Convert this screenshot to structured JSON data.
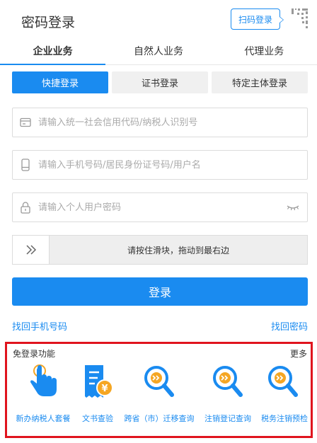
{
  "header": {
    "title": "密码登录",
    "scan_label": "扫码登录"
  },
  "tabs": [
    {
      "label": "企业业务",
      "active": true
    },
    {
      "label": "自然人业务",
      "active": false
    },
    {
      "label": "代理业务",
      "active": false
    }
  ],
  "login_modes": [
    {
      "label": "快捷登录",
      "active": true
    },
    {
      "label": "证书登录",
      "active": false
    },
    {
      "label": "特定主体登录",
      "active": false
    }
  ],
  "fields": {
    "credit_code_placeholder": "请输入统一社会信用代码/纳税人识别号",
    "phone_placeholder": "请输入手机号码/居民身份证号码/用户名",
    "password_placeholder": "请输入个人用户密码"
  },
  "slider": {
    "text": "请按住滑块，拖动到最右边"
  },
  "login_button": "登录",
  "links": {
    "recover_phone": "找回手机号码",
    "recover_password": "找回密码"
  },
  "free_login": {
    "title": "免登录功能",
    "more": "更多",
    "items": [
      {
        "label": "新办纳税人套餐",
        "icon": "hand-tap-icon"
      },
      {
        "label": "文书查验",
        "icon": "document-yuan-icon"
      },
      {
        "label": "跨省（市）迁移查询",
        "icon": "search-magnifier-icon"
      },
      {
        "label": "注销登记查询",
        "icon": "search-magnifier-icon"
      },
      {
        "label": "税务注销预检",
        "icon": "search-magnifier-icon"
      }
    ]
  },
  "colors": {
    "accent": "#1a8bf0",
    "highlight_border": "#e0141e",
    "icon_orange": "#f5a623"
  }
}
